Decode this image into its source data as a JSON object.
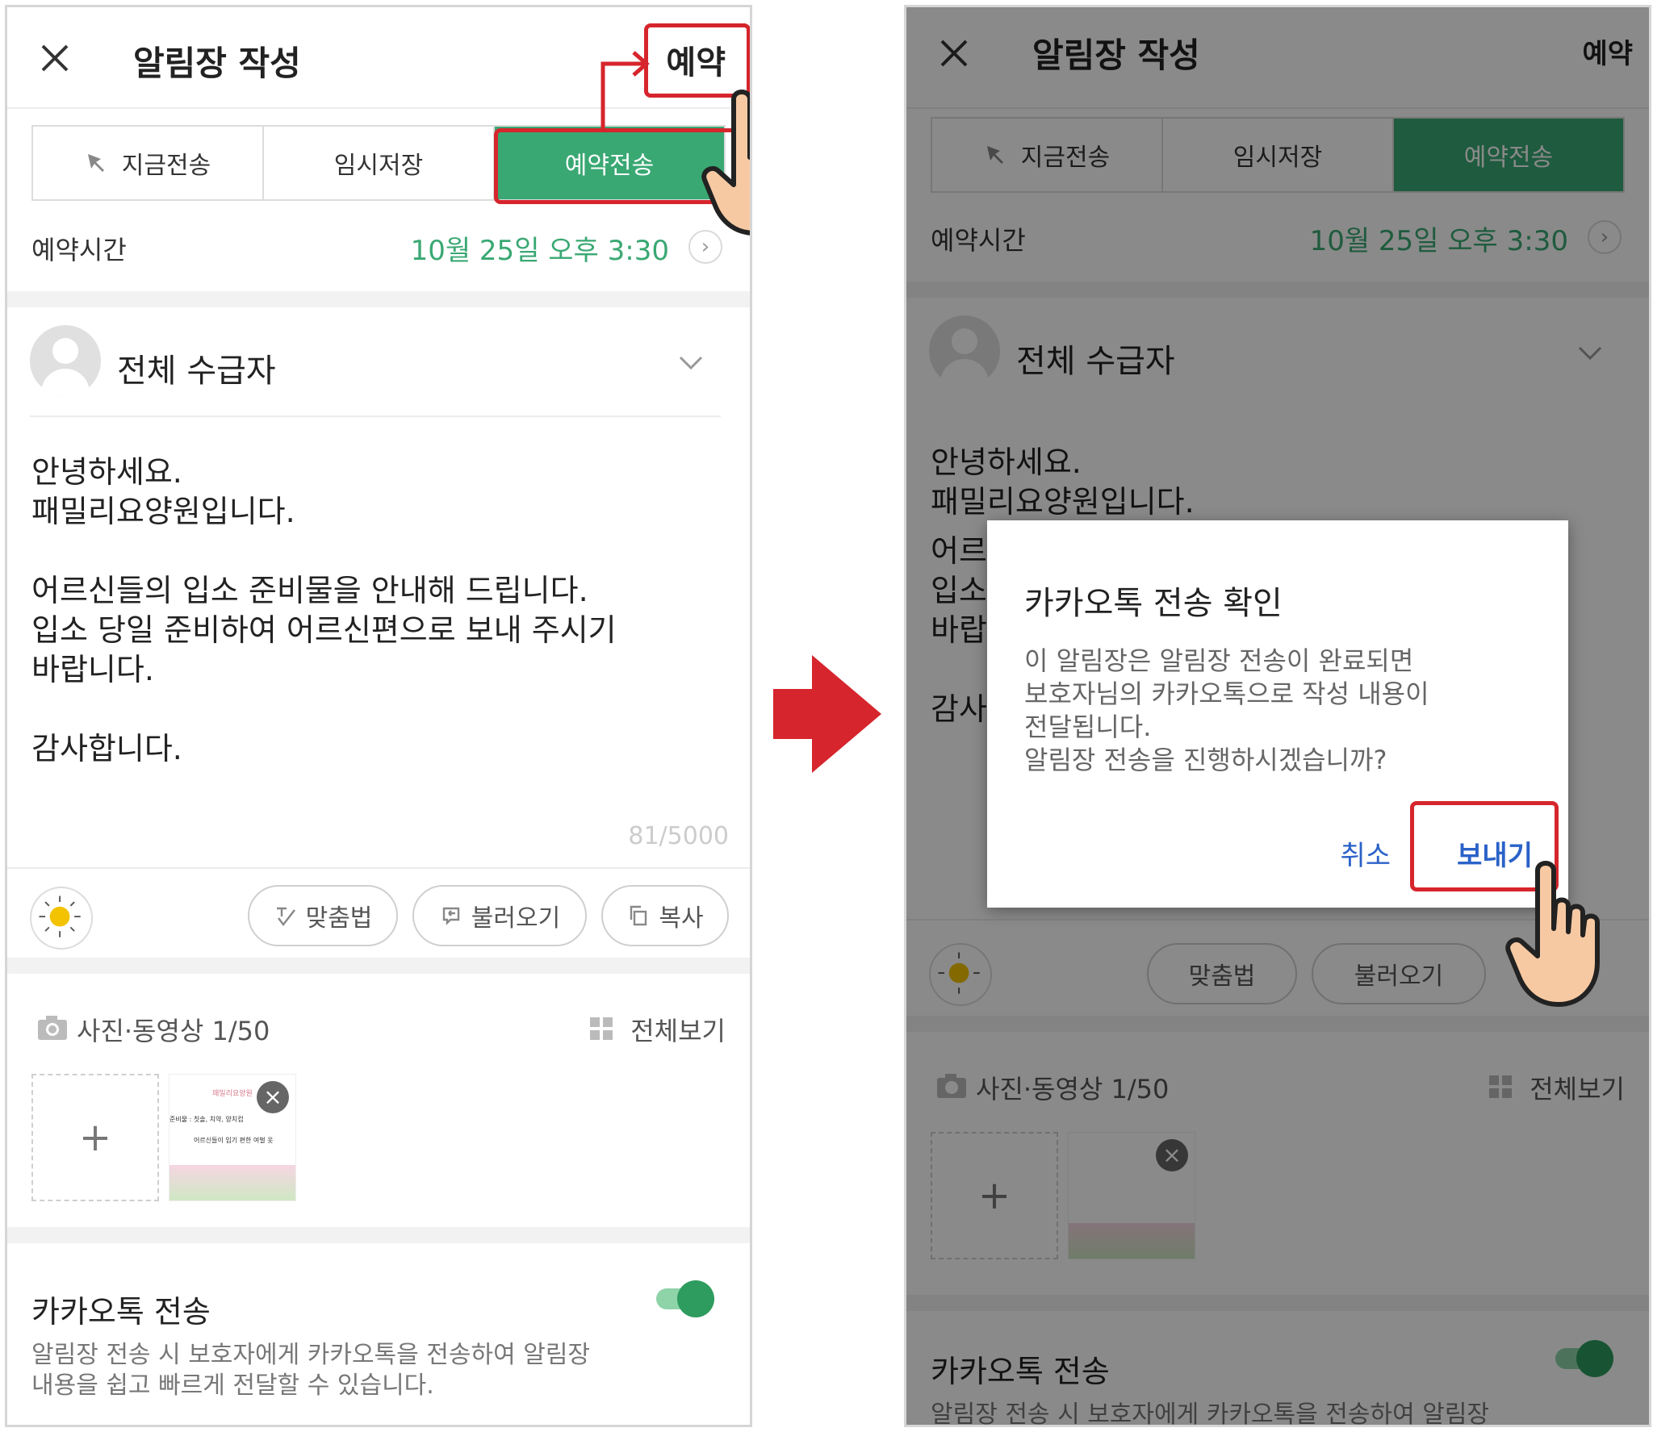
{
  "colors": {
    "accent_green": "#3aa873",
    "highlight_red": "#d6252c",
    "link_blue": "#2b62c8"
  },
  "left": {
    "header": {
      "close_icon": "close-icon",
      "title": "알림장 작성",
      "reserve_label": "예약"
    },
    "tabs": [
      {
        "label": "지금전송",
        "icon": "pin-icon",
        "active": false
      },
      {
        "label": "임시저장",
        "active": false
      },
      {
        "label": "예약전송",
        "active": true
      }
    ],
    "schedule": {
      "label": "예약시간",
      "value": "10월 25일 오후 3:30"
    },
    "recipient": {
      "label": "전체 수급자"
    },
    "message": {
      "lines": [
        "안녕하세요.",
        "패밀리요양원입니다.",
        "",
        "어르신들의 입소 준비물을 안내해 드립니다.",
        "입소 당일 준비하여 어르신편으로 보내 주시기",
        "바랍니다.",
        "",
        "감사합니다."
      ]
    },
    "char_count": "81/5000",
    "toolbar": {
      "spelling_label": "맞춤법",
      "load_label": "불러오기",
      "copy_label": "복사"
    },
    "media": {
      "label": "사진·동영상 1/50",
      "view_all_label": "전체보기",
      "add_label": "+",
      "thumbnail": {
        "title_text": "패밀리요양원",
        "line1": "준비물 : 칫솔, 치약, 양치컵",
        "line2": "어르신들이 입기 편한 여벌 옷"
      }
    },
    "kakao": {
      "title": "카카오톡 전송",
      "enabled": true,
      "desc_lines": [
        "알림장 전송 시 보호자에게 카카오톡을 전송하여 알림장",
        "내용을 쉽고 빠르게 전달할 수 있습니다."
      ]
    }
  },
  "right": {
    "header": {
      "title": "알림장 작성",
      "reserve_label": "예약"
    },
    "tabs": [
      {
        "label": "지금전송",
        "active": false
      },
      {
        "label": "임시저장",
        "active": false
      },
      {
        "label": "예약전송",
        "active": true
      }
    ],
    "schedule": {
      "label": "예약시간",
      "value": "10월 25일 오후 3:30"
    },
    "recipient": {
      "label": "전체 수급자"
    },
    "message_visible_lines": [
      "안녕하세요.",
      "패밀리요양원입니다.",
      "어르",
      "입소",
      "바랍",
      "",
      "감사"
    ],
    "toolbar": {
      "spelling_label": "맞춤법",
      "load_label": "불러오기"
    },
    "media": {
      "label": "사진·동영상 1/50",
      "view_all_label": "전체보기"
    },
    "kakao": {
      "title": "카카오톡 전송",
      "desc_partial": "알림장 전송 시 보호자에게 카카오톡을 전송하여 알림장"
    },
    "dialog": {
      "title": "카카오톡 전송 확인",
      "body_lines": [
        "이 알림장은 알림장 전송이 완료되면",
        "보호자님의 카카오톡으로 작성 내용이",
        "전달됩니다.",
        "알림장 전송을 진행하시겠습니까?"
      ],
      "cancel_label": "취소",
      "send_label": "보내기"
    }
  }
}
